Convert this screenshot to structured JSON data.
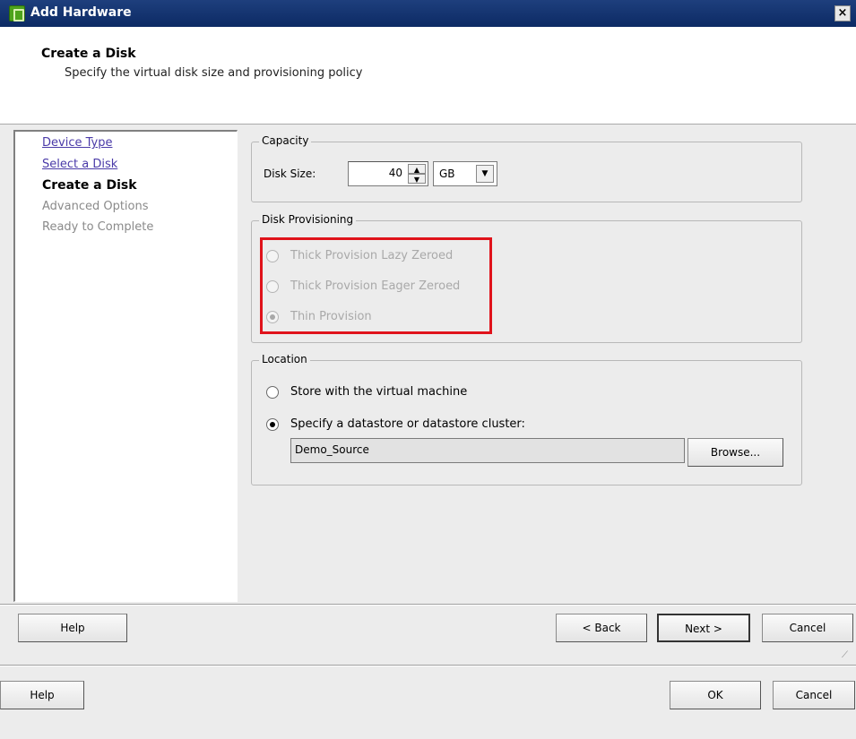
{
  "window": {
    "title": "Add Hardware",
    "close": "×"
  },
  "header": {
    "title": "Create a Disk",
    "subtitle": "Specify the virtual disk size and provisioning policy"
  },
  "steps": [
    {
      "label": "Device Type",
      "state": "done"
    },
    {
      "label": "Select a Disk",
      "state": "done"
    },
    {
      "label": "Create a Disk",
      "state": "current"
    },
    {
      "label": "Advanced Options",
      "state": "future"
    },
    {
      "label": "Ready to Complete",
      "state": "future"
    }
  ],
  "capacity": {
    "legend": "Capacity",
    "disk_size_label": "Disk Size:",
    "disk_size_value": "40",
    "unit": "GB"
  },
  "provisioning": {
    "legend": "Disk Provisioning",
    "options": [
      {
        "label": "Thick Provision Lazy Zeroed",
        "checked": false,
        "enabled": false
      },
      {
        "label": "Thick Provision Eager Zeroed",
        "checked": false,
        "enabled": false
      },
      {
        "label": "Thin Provision",
        "checked": true,
        "enabled": false
      }
    ],
    "highlight_color": "#e0131b"
  },
  "location": {
    "legend": "Location",
    "options": [
      {
        "label": "Store with the virtual machine",
        "checked": false
      },
      {
        "label": "Specify a datastore or datastore cluster:",
        "checked": true
      }
    ],
    "datastore": "Demo_Source",
    "browse_label": "Browse..."
  },
  "wizard_buttons": {
    "help": "Help",
    "back": "< Back",
    "next": "Next >",
    "cancel": "Cancel"
  },
  "outer_buttons": {
    "help": "Help",
    "ok": "OK",
    "cancel": "Cancel"
  }
}
